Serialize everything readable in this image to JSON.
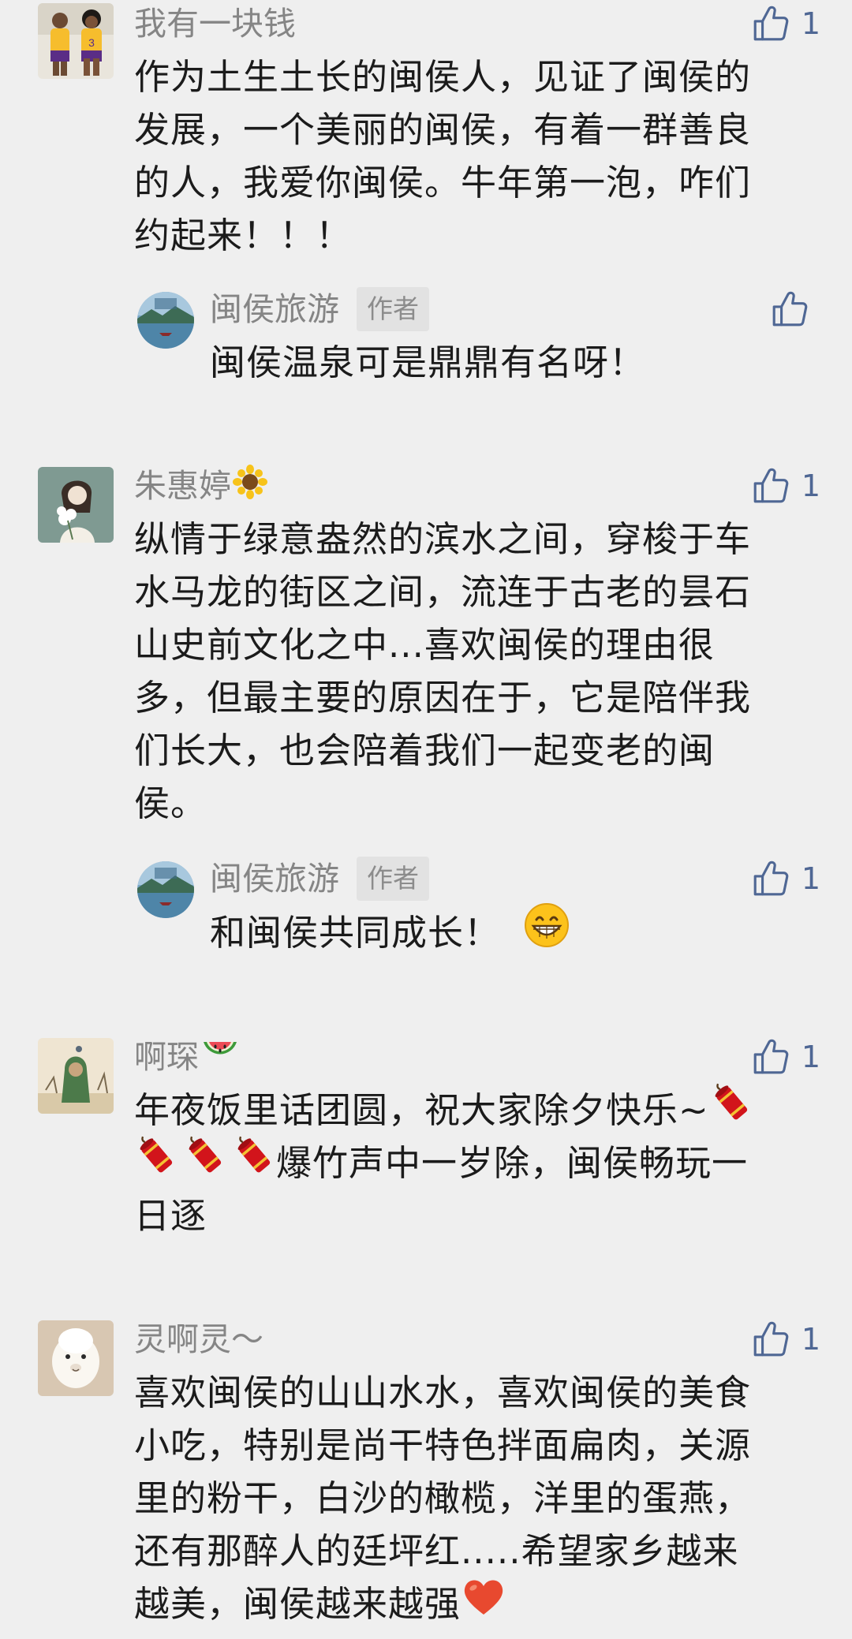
{
  "colors": {
    "background": "#efefef",
    "nickname": "#858585",
    "like_icon": "#4f6794",
    "author_badge_bg": "#e2e2e2",
    "text": "#1b1b1b"
  },
  "comments": [
    {
      "nickname": "我有一块钱",
      "avatar": "two-basketball-players-avatar",
      "likes": "1",
      "lines": [
        "作为土生土长的闽侯人，见证了闽侯的",
        "发展，一个美丽的闽侯，有着一群善良",
        "的人，我爱你闽侯。牛年第一泡，咋们",
        "约起来！！！"
      ],
      "reply": {
        "nickname": "闽侯旅游",
        "badge": "作者",
        "likes": "",
        "text": "闽侯温泉可是鼎鼎有名呀！"
      }
    },
    {
      "nickname": "朱惠婷",
      "nickname_emoji": "sunflower-emoji",
      "avatar": "girl-with-flowers-avatar",
      "likes": "1",
      "lines": [
        "纵情于绿意盎然的滨水之间，穿梭于车",
        "水马龙的街区之间，流连于古老的昙石",
        "山史前文化之中...喜欢闽侯的理由很",
        "多，但最主要的原因在于，它是陪伴我",
        "们长大，也会陪着我们一起变老的闽",
        "侯。"
      ],
      "reply": {
        "nickname": "闽侯旅游",
        "badge": "作者",
        "likes": "1",
        "text": "和闽侯共同成长！",
        "emoji": "grinning-face-emoji"
      }
    },
    {
      "nickname": "啊琛",
      "nickname_emoji": "watermelon-emoji",
      "avatar": "green-hooded-figure-avatar",
      "likes": "1",
      "line1": "年夜饭里话团圆，祝大家除夕快乐~",
      "line2_text": "爆竹声中一岁除，闽侯畅玩一",
      "line3": "日逐",
      "emoji": "firecracker-emoji"
    },
    {
      "nickname": "灵啊灵～",
      "avatar": "white-alpaca-avatar",
      "likes": "1",
      "lines": [
        "喜欢闽侯的山山水水，喜欢闽侯的美食",
        "小吃，特别是尚干特色拌面扁肉，关源",
        "里的粉干，白沙的橄榄，洋里的蛋燕，",
        "还有那醉人的廷坪红.....希望家乡越来"
      ],
      "last_line": "越美，闽侯越来越强",
      "emoji": "red-heart-emoji"
    }
  ]
}
